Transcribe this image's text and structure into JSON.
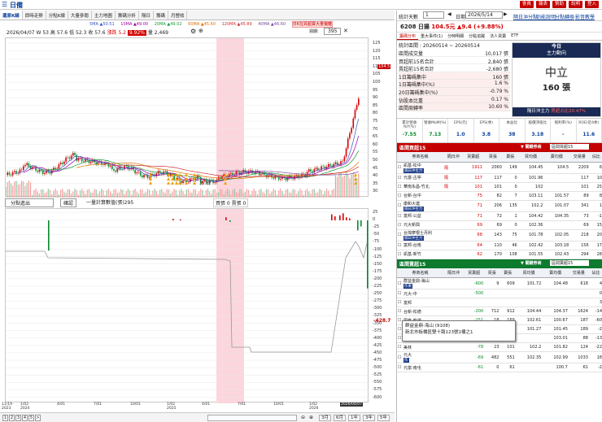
{
  "app": {
    "title": "日備",
    "buttons": [
      "會員",
      "報表",
      "贊助",
      "說明",
      "登入"
    ]
  },
  "tabs": [
    {
      "label": "還原K線",
      "on": true
    },
    {
      "label": "即時走勢"
    },
    {
      "label": "分點K線"
    },
    {
      "label": "大量參閱"
    },
    {
      "label": "主力地圖"
    },
    {
      "label": "籌碼分析"
    },
    {
      "label": "隔日"
    },
    {
      "label": "籌碼"
    },
    {
      "label": "月營收"
    }
  ],
  "ma": {
    "m5": "5MA ▲50.51",
    "m10": "10MA ▲49.00",
    "m20": "20MA ▲49.02",
    "m60": "60MA ▲45.60",
    "m120": "120MA ▲45.89",
    "m240": "240MA",
    "m40": "40MA ▲46.60",
    "tag": "日K在買超賣大量偏離"
  },
  "info": {
    "date": "2026/04/07",
    "w": "W 53",
    "h": "高 57.6",
    "l": "低 52.3",
    "c": "收 57.6",
    "chg": "漲跌 5.2",
    "pct": "9.92%",
    "vol": "量 2,469",
    "sel": "395"
  },
  "price_axis": [
    "125",
    "120",
    "115",
    "110",
    "105",
    "100",
    "95",
    "90",
    "85",
    "80",
    "75",
    "70",
    "65",
    "60",
    "55",
    "50",
    "45",
    "40",
    "35",
    "30"
  ],
  "price_tag": "104.5",
  "low_tag": "35.82",
  "sub": {
    "sel": "分點進出",
    "btn": "確認",
    "legend1": "一量計算數值(張)295",
    "legend2": "買張 0  賣張 0",
    "axis": [
      "25",
      "0",
      "-25",
      "-50",
      "-75",
      "-100",
      "-125",
      "-150",
      "-175",
      "-200",
      "-225",
      "-250",
      "-275",
      "-300",
      "-325",
      "-350",
      "-375",
      "-400",
      "-425",
      "-450",
      "-475",
      "-500",
      "-525",
      "-550",
      "-575",
      "-600"
    ],
    "tag": "-428.7"
  },
  "xaxis": [
    "11/19\n2023",
    "1/02\n2024",
    "4/01",
    "7/01",
    "10/01",
    "1/02\n2025",
    "4/01",
    "7/01",
    "10/01",
    "1/02\n2026",
    "2026/04/07"
  ],
  "pager": {
    "pages": [
      "1",
      "2",
      "3",
      "4",
      "5",
      ">"
    ],
    "ranges": [
      "3月",
      "6月",
      "1年",
      "3年",
      "5年"
    ]
  },
  "rp": {
    "top": {
      "label": "統計天數",
      "days": "1",
      "date_label": "日期",
      "date": "2026/5/14",
      "btns": [
        "隔日沖分點",
        "功能說明",
        "分點轉換",
        "影音教學"
      ]
    },
    "stock": "6208 日揚",
    "price": "104.5元",
    "change": "▲9.4 (+9.88%)",
    "subtabs": [
      "籌碼分布",
      "重大事件(1)",
      "分時明細",
      "分點追蹤",
      "法人買賣",
      "ETF"
    ],
    "stats_title": "統計區間 : 20260514 ~ 20260514",
    "stats": [
      {
        "k": "區間成交量",
        "v": "10,017 張"
      },
      {
        "k": "買超前15名合計",
        "v": "2,840 張"
      },
      {
        "k": "賣超前15名合計",
        "v": "-2,680 張"
      },
      {
        "k": "1日籌碼集中",
        "v": "160 張"
      },
      {
        "k": "1日籌碼集中(%)",
        "v": "1.6 %"
      },
      {
        "k": "20日籌碼集中(%)",
        "v": "-0.79 %"
      },
      {
        "k": "佔股本比重",
        "v": "0.17 %"
      },
      {
        "k": "區間周轉率",
        "v": "10.60 %"
      }
    ],
    "main": {
      "head": "今日",
      "sub": "主力動向",
      "big": "中立",
      "val": "160 張",
      "foot": "隔日沖主力",
      "foot2": "買超占比20.47%"
    },
    "fin": {
      "h": [
        "累計營收YoY(%)",
        "營收MoM(%)",
        "EPS(元)",
        "EPS(季)",
        "本益比",
        "股價淨值比",
        "殖利率(%)",
        "ROE(近4季)"
      ],
      "v": [
        "-7.55",
        "7.13",
        "1.0",
        "3.8",
        "38",
        "3.18",
        "-",
        "11.6"
      ]
    },
    "buy": {
      "title": "區間買超15",
      "sel": "關鍵券商",
      "sel2": "區間買超15",
      "cols": [
        "券商名稱",
        "隔日沖",
        "買賣超",
        "買張",
        "賣張",
        "買均價",
        "賣均價",
        "交易量",
        "佔比"
      ],
      "rows": [
        [
          "凱基-松中",
          "隔日沖主力",
          "隔",
          "1911",
          "2060",
          "149",
          "104.45",
          "104.5",
          "2209",
          "6"
        ],
        [
          "元富-古亭",
          "",
          "隔",
          "117",
          "117",
          "0",
          "101.96",
          "",
          "117",
          "10"
        ],
        [
          "華南永昌-竹北",
          "",
          "隔",
          "101",
          "101",
          "0",
          "102",
          "",
          "101",
          "25"
        ],
        [
          "台新-台中",
          "",
          "",
          "75",
          "82",
          "7",
          "103.11",
          "101.57",
          "89",
          "8"
        ],
        [
          "康和大連",
          "隔日沖主力",
          "",
          "71",
          "206",
          "135",
          "102.2",
          "101.07",
          "341",
          "1"
        ],
        [
          "富邦-公益",
          "",
          "",
          "71",
          "72",
          "1",
          "104.42",
          "104.35",
          "73",
          "-1"
        ],
        [
          "元大新興",
          "",
          "",
          "69",
          "69",
          "0",
          "102.36",
          "",
          "69",
          "15"
        ],
        [
          "台灣摩根士丹利",
          "隔日沖主力",
          "",
          "68",
          "143",
          "75",
          "101.78",
          "102.05",
          "218",
          "20"
        ],
        [
          "富邦-台南",
          "",
          "",
          "64",
          "110",
          "46",
          "102.42",
          "103.18",
          "156",
          "17"
        ],
        [
          "凱基-新竹",
          "",
          "",
          "62",
          "170",
          "108",
          "101.55",
          "102.43",
          "294",
          "28"
        ]
      ]
    },
    "sell": {
      "title": "區間賣超15",
      "sel": "關鍵券商",
      "sel2": "區間賣超15",
      "cols": [
        "券商名稱",
        "隔日沖",
        "買賣超",
        "買張",
        "賣張",
        "買均價",
        "賣均價",
        "交易量",
        "佔比"
      ],
      "rows": [
        [
          "群益金鼎-海山",
          "作東",
          "",
          "-600",
          "9",
          "609",
          "101.72",
          "104.48",
          "618",
          "4"
        ],
        [
          "元大-中",
          "",
          "",
          "-500",
          "",
          "",
          "",
          "",
          "",
          "0"
        ],
        [
          "富邦",
          "",
          "",
          "",
          "",
          "",
          "",
          "",
          "",
          "3"
        ],
        [
          "台新-松德",
          "",
          "",
          "-200",
          "712",
          "912",
          "104.44",
          "104.37",
          "1624",
          "-14"
        ],
        [
          "國泰-龍潭",
          "",
          "",
          "-151",
          "18",
          "169",
          "102.61",
          "100.67",
          "187",
          "-60"
        ],
        [
          "美商高盛",
          "",
          "",
          "-107",
          "41",
          "148",
          "101.27",
          "101.45",
          "189",
          "-2"
        ],
        [
          "康泰-中正",
          "",
          "",
          "-88",
          "0",
          "88",
          "",
          "103.01",
          "88",
          "-13"
        ],
        [
          "美林",
          "",
          "",
          "-78",
          "23",
          "101",
          "102.2",
          "101.82",
          "124",
          "-22"
        ],
        [
          "元大",
          "作",
          "",
          "-69",
          "482",
          "551",
          "102.35",
          "102.99",
          "1033",
          "18"
        ],
        [
          "元富-南屯",
          "",
          "",
          "-61",
          "0",
          "61",
          "",
          "100.7",
          "61",
          "-2"
        ]
      ]
    },
    "tooltip": {
      "name": "群益金鼎-海山 (9108)",
      "addr": "新北市板橋區雙十路123號1樓之1"
    }
  }
}
